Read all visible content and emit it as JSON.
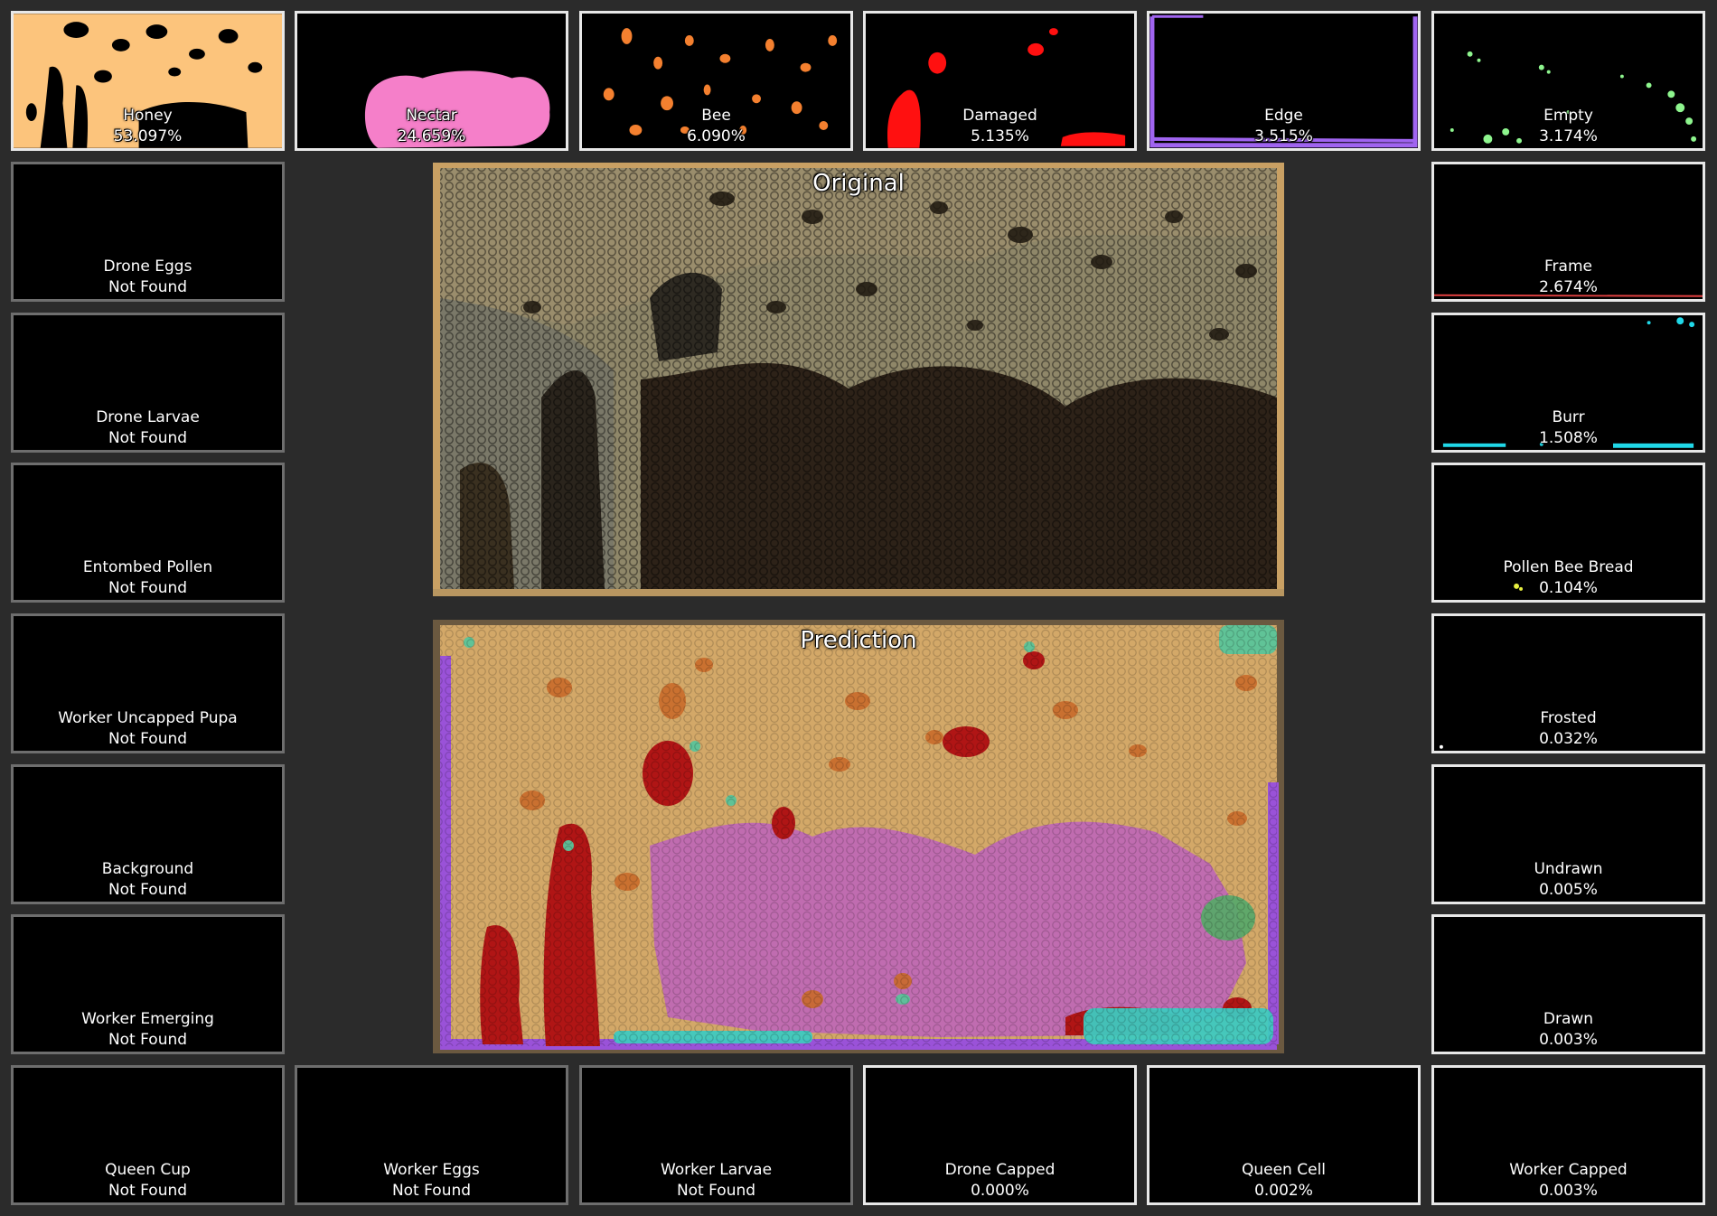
{
  "status_not_found": "Not Found",
  "tiles": {
    "honey": {
      "name": "Honey",
      "value": "53.097%",
      "color": "#fcc47c"
    },
    "nectar": {
      "name": "Nectar",
      "value": "24.659%",
      "color": "#f57fc9"
    },
    "bee": {
      "name": "Bee",
      "value": "6.090%",
      "color": "#f4802f"
    },
    "damaged": {
      "name": "Damaged",
      "value": "5.135%",
      "color": "#ff1010"
    },
    "edge": {
      "name": "Edge",
      "value": "3.515%",
      "color": "#a064f0"
    },
    "empty": {
      "name": "Empty",
      "value": "3.174%",
      "color": "#8ef58e"
    },
    "drone_eggs": {
      "name": "Drone Eggs",
      "value": "Not Found"
    },
    "drone_larvae": {
      "name": "Drone Larvae",
      "value": "Not Found"
    },
    "entombed_pollen": {
      "name": "Entombed Pollen",
      "value": "Not Found"
    },
    "worker_uncapped_pupa": {
      "name": "Worker Uncapped Pupa",
      "value": "Not Found"
    },
    "background": {
      "name": "Background",
      "value": "Not Found"
    },
    "worker_emerging": {
      "name": "Worker Emerging",
      "value": "Not Found"
    },
    "frame": {
      "name": "Frame",
      "value": "2.674%",
      "color": "#e04040"
    },
    "burr": {
      "name": "Burr",
      "value": "1.508%",
      "color": "#20d8e8"
    },
    "pollen_bee_bread": {
      "name": "Pollen Bee Bread",
      "value": "0.104%",
      "color": "#e8f040"
    },
    "frosted": {
      "name": "Frosted",
      "value": "0.032%",
      "color": "#ffffff"
    },
    "undrawn": {
      "name": "Undrawn",
      "value": "0.005%",
      "color": "#ffffff"
    },
    "drawn": {
      "name": "Drawn",
      "value": "0.003%",
      "color": "#ffffff"
    },
    "queen_cup": {
      "name": "Queen Cup",
      "value": "Not Found"
    },
    "worker_eggs": {
      "name": "Worker Eggs",
      "value": "Not Found"
    },
    "worker_larvae": {
      "name": "Worker Larvae",
      "value": "Not Found"
    },
    "drone_capped": {
      "name": "Drone Capped",
      "value": "0.000%"
    },
    "queen_cell": {
      "name": "Queen Cell",
      "value": "0.002%"
    },
    "worker_capped": {
      "name": "Worker Capped",
      "value": "0.003%"
    }
  },
  "original": {
    "title": "Original"
  },
  "prediction": {
    "title": "Prediction"
  }
}
